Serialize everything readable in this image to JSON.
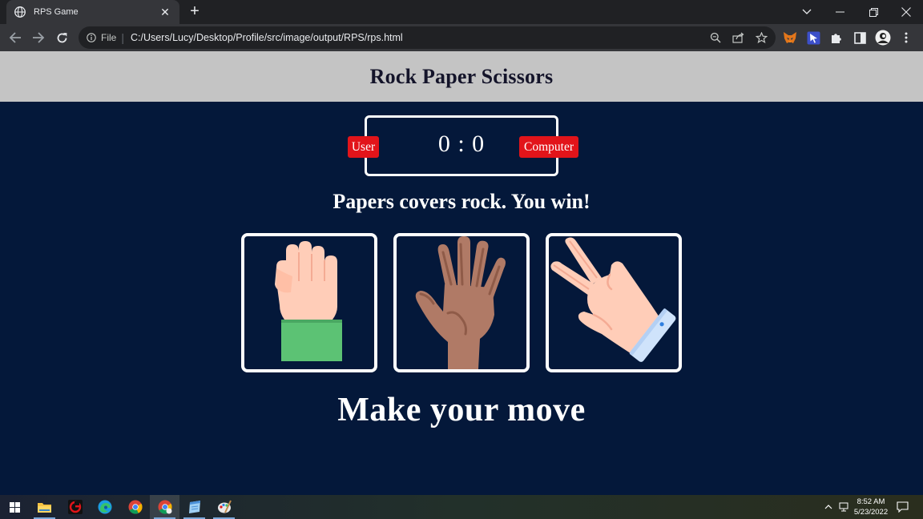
{
  "browser": {
    "tab_title": "RPS Game",
    "tab_close": "✕",
    "new_tab": "+",
    "omnibox": {
      "scheme_label": "File",
      "url": "C:/Users/Lucy/Desktop/Profile/src/image/output/RPS/rps.html"
    }
  },
  "page": {
    "header_title": "Rock Paper Scissors",
    "score": {
      "user_label": "User",
      "computer_label": "Computer",
      "display": "0 : 0",
      "user": 0,
      "computer": 0
    },
    "result_message": "Papers covers rock. You win!",
    "choices": [
      {
        "id": "rock",
        "icon": "fist-icon"
      },
      {
        "id": "paper",
        "icon": "open-hand-icon"
      },
      {
        "id": "scissors",
        "icon": "peace-hand-icon"
      }
    ],
    "prompt": "Make your move"
  },
  "taskbar": {
    "time": "8:52 AM",
    "date": "5/23/2022"
  },
  "colors": {
    "page_bg": "#04183a",
    "header_bg": "#c4c4c4",
    "badge_red": "#e2141a",
    "skin_light": "#ffcdb8",
    "skin_dark": "#b07a66",
    "sleeve_green": "#5cc274",
    "cuff_blue": "#cfe3fb"
  }
}
